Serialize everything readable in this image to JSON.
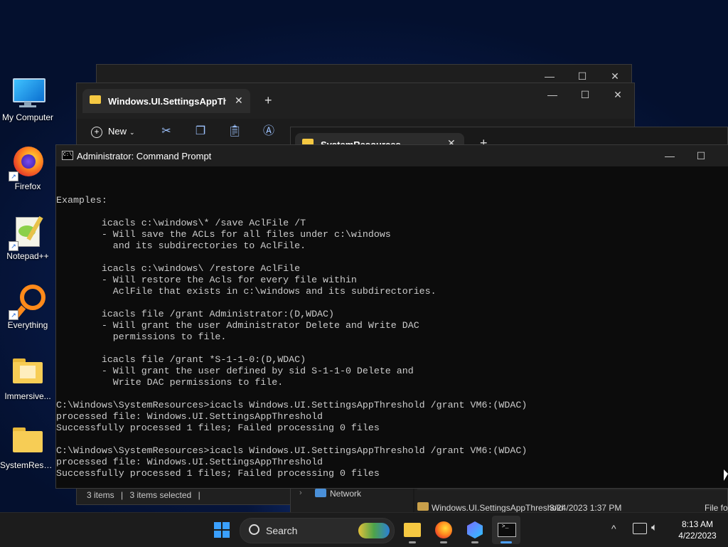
{
  "desktop": {
    "icons": [
      {
        "label": "My Computer"
      },
      {
        "label": "Firefox"
      },
      {
        "label": "Notepad++"
      },
      {
        "label": "Everything"
      },
      {
        "label": "Immersive..."
      },
      {
        "label": "SystemReso..."
      }
    ]
  },
  "explorer_back": {
    "tab_title": "Windows.UI.SettingsAppThre:",
    "new_label": "New",
    "status_items": "3 items",
    "status_selected": "3 items selected",
    "status_sep": "|"
  },
  "explorer_front": {
    "tab_title": "SystemResources",
    "nav_network": "Network",
    "rows": [
      {
        "name": "Windows.UI.SettingsAppThreshold",
        "date": "3/24/2023 1:37 PM",
        "type": "File fol"
      }
    ]
  },
  "cmd": {
    "title": "Administrator: Command Prompt",
    "lines": [
      "Examples:",
      "",
      "        icacls c:\\windows\\* /save AclFile /T",
      "        - Will save the ACLs for all files under c:\\windows",
      "          and its subdirectories to AclFile.",
      "",
      "        icacls c:\\windows\\ /restore AclFile",
      "        - Will restore the Acls for every file within",
      "          AclFile that exists in c:\\windows and its subdirectories.",
      "",
      "        icacls file /grant Administrator:(D,WDAC)",
      "        - Will grant the user Administrator Delete and Write DAC",
      "          permissions to file.",
      "",
      "        icacls file /grant *S-1-1-0:(D,WDAC)",
      "        - Will grant the user defined by sid S-1-1-0 Delete and",
      "          Write DAC permissions to file.",
      "",
      "C:\\Windows\\SystemResources>icacls Windows.UI.SettingsAppThreshold /grant VM6:(WDAC)",
      "processed file: Windows.UI.SettingsAppThreshold",
      "Successfully processed 1 files; Failed processing 0 files",
      "",
      "C:\\Windows\\SystemResources>icacls Windows.UI.SettingsAppThreshold /grant VM6:(WDAC)",
      "processed file: Windows.UI.SettingsAppThreshold",
      "Successfully processed 1 files; Failed processing 0 files",
      "",
      "C:\\Windows\\SystemResources>"
    ]
  },
  "taskbar": {
    "search_label": "Search",
    "time": "8:13 AM",
    "date": "4/22/2023"
  },
  "colors": {
    "accent": "#0078d4",
    "cmd_bg": "#0c0c0c",
    "cmd_text": "#cccccc"
  }
}
